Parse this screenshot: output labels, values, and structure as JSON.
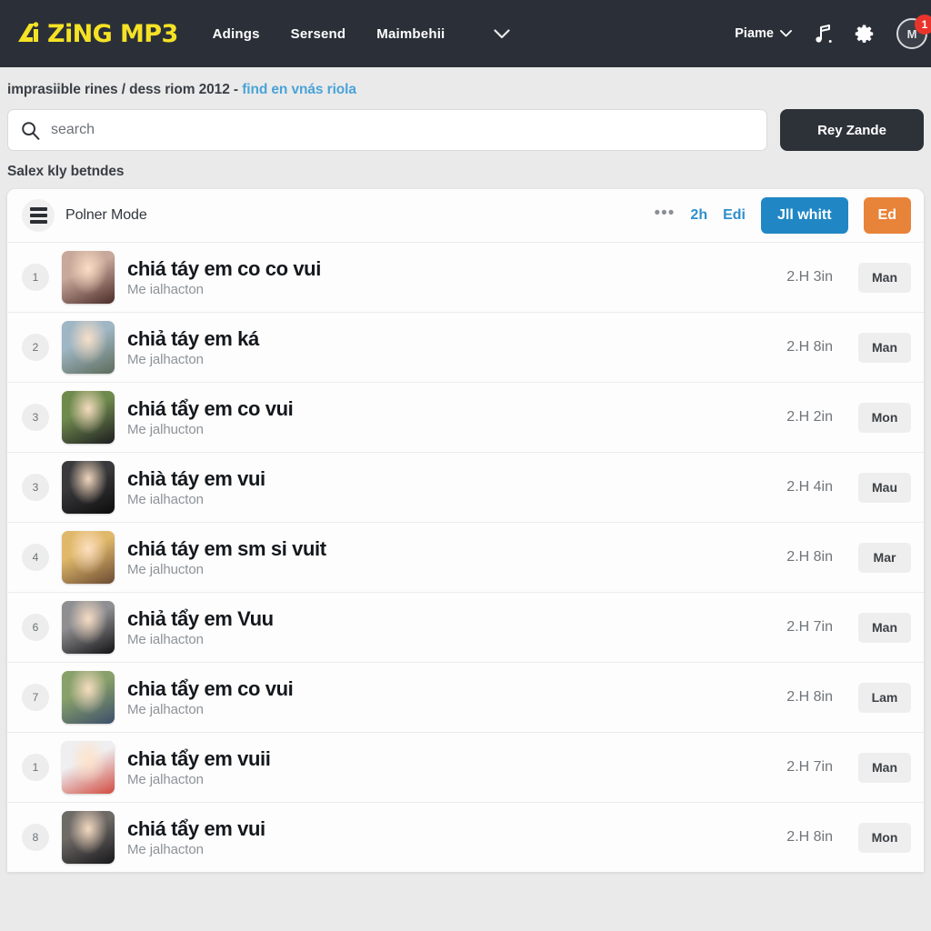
{
  "nav": {
    "logo_text": "ZiNG MP3",
    "links": [
      {
        "label": "Adings"
      },
      {
        "label": "Sersend"
      },
      {
        "label": "Maimbehii"
      }
    ],
    "caret": "⌄",
    "user_label": "Piame",
    "user_caret": "⌄",
    "music_icon": "music-note-icon",
    "gear_icon": "gear-icon",
    "avatar_initial": "M",
    "notification_count": "1"
  },
  "breadcrumb": {
    "text": "imprasiible rines / dess riom 2012 - ",
    "link": "find en vnás riola"
  },
  "search": {
    "placeholder": "search",
    "value": "",
    "button_label": "Rey Zande"
  },
  "section": {
    "label": "Salex kly betndes"
  },
  "toolbar": {
    "title": "Polner Mode",
    "dots": "•••",
    "time_link": "2h",
    "edit_link": "Edi",
    "primary_label": "Jll whitt",
    "accent_label": "Ed"
  },
  "colors": {
    "logo_yellow": "#f5e225",
    "nav_bg": "#2b3038",
    "page_bg": "#eaeaea",
    "link_blue": "#4aa3d8",
    "primary_blue": "#2087c4",
    "accent_orange": "#e8833a",
    "badge_red": "#e8342b",
    "dark_button": "#2d3239"
  },
  "tracks": [
    {
      "rank": "1",
      "title": "chiá táy em co co vui",
      "subtitle": "Me ialhacton",
      "duration": "2.H 3in",
      "badge": "Man",
      "thumb_a": "#c8a89a",
      "thumb_b": "#4a2b28"
    },
    {
      "rank": "2",
      "title": "chiả táy em ká",
      "subtitle": "Me jalhacton",
      "duration": "2.H 8in",
      "badge": "Man",
      "thumb_a": "#9fb6c4",
      "thumb_b": "#5c6b5a"
    },
    {
      "rank": "3",
      "title": "chiá tẩy em co vui",
      "subtitle": "Me jalhucton",
      "duration": "2.H 2in",
      "badge": "Mon",
      "thumb_a": "#6f8a4d",
      "thumb_b": "#1d1d20"
    },
    {
      "rank": "3",
      "title": "chià táy em vui",
      "subtitle": "Me ialhacton",
      "duration": "2.H 4in",
      "badge": "Mau",
      "thumb_a": "#3a3a3c",
      "thumb_b": "#0c0c0d"
    },
    {
      "rank": "4",
      "title": "chiá táy em sm si vuit",
      "subtitle": "Me jalhucton",
      "duration": "2.H 8in",
      "badge": "Mar",
      "thumb_a": "#e0b86a",
      "thumb_b": "#6b4a33"
    },
    {
      "rank": "6",
      "title": "chiả tẩy em Vuu",
      "subtitle": "Me ialhacton",
      "duration": "2.H 7in",
      "badge": "Man",
      "thumb_a": "#8f8f92",
      "thumb_b": "#121214"
    },
    {
      "rank": "7",
      "title": "chia tẩy em co vui",
      "subtitle": "Me jalhacton",
      "duration": "2.H 8in",
      "badge": "Lam",
      "thumb_a": "#88a06a",
      "thumb_b": "#3c4f6b"
    },
    {
      "rank": "1",
      "title": "chia tẩy em vuii",
      "subtitle": "Me jalhacton",
      "duration": "2.H 7in",
      "badge": "Man",
      "thumb_a": "#efeff1",
      "thumb_b": "#d14a3f"
    },
    {
      "rank": "8",
      "title": "chiá tẩy em vui",
      "subtitle": "Me jalhacton",
      "duration": "2.H 8in",
      "badge": "Mon",
      "thumb_a": "#6e6a66",
      "thumb_b": "#17171a"
    }
  ]
}
